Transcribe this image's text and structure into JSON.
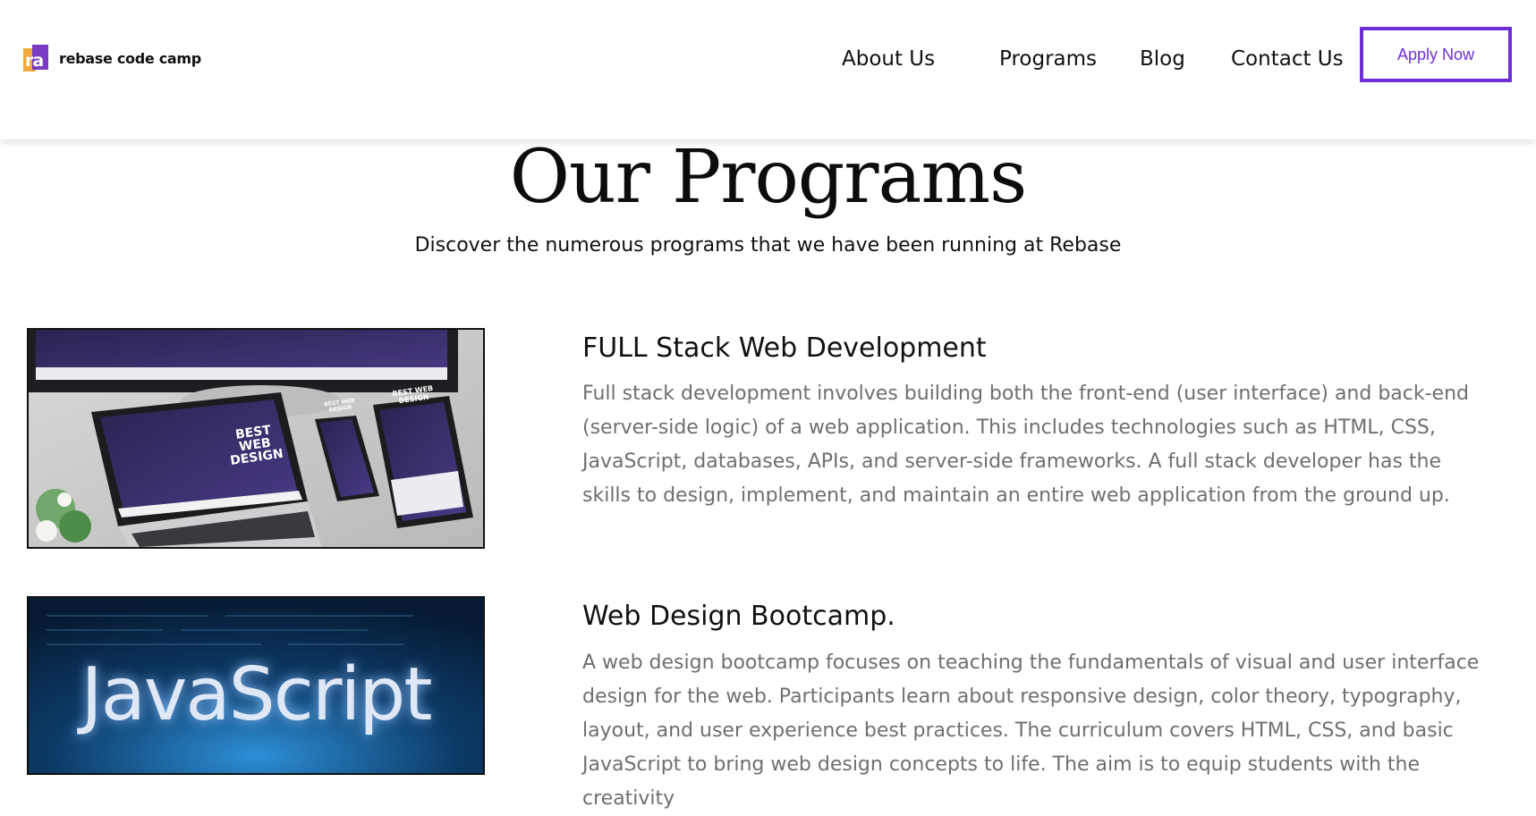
{
  "header": {
    "brand_name": "rebase code camp",
    "logo_glyph": "ra",
    "nav": [
      {
        "label": "About Us"
      },
      {
        "label": "Programs"
      },
      {
        "label": "Blog"
      },
      {
        "label": "Contact Us"
      }
    ],
    "apply_label": "Apply Now"
  },
  "hero": {
    "title": "Our Programs",
    "subtitle": "Discover the numerous programs that we have been running at Rebase"
  },
  "programs": [
    {
      "title": "FULL Stack Web Development",
      "description": "Full stack development involves building both the front-end (user interface) and back-end (server-side logic) of a web application. This includes technologies such as HTML, CSS, JavaScript, databases, APIs, and server-side frameworks. A full stack developer has the skills to design, implement, and maintain an entire web application from the ground up.",
      "image_text": {
        "laptop": "BEST WEB DESIGN",
        "tablet": "BEST WEB DESIGN",
        "phone": "BEST WEB DESIGN"
      }
    },
    {
      "title": "Web Design Bootcamp.",
      "description": "A web design bootcamp focuses on teaching the fundamentals of visual and user interface design for the web. Participants learn about responsive design, color theory, typography, layout, and user experience best practices. The curriculum covers HTML, CSS, and basic JavaScript to bring web design concepts to life. The aim is to equip students with the creativity",
      "image_text": "JavaScript"
    }
  ],
  "colors": {
    "accent": "#6e2fd6",
    "logo_orange": "#f2a93b",
    "logo_purple": "#7a3bc4",
    "body_text": "#6f6f6f"
  }
}
